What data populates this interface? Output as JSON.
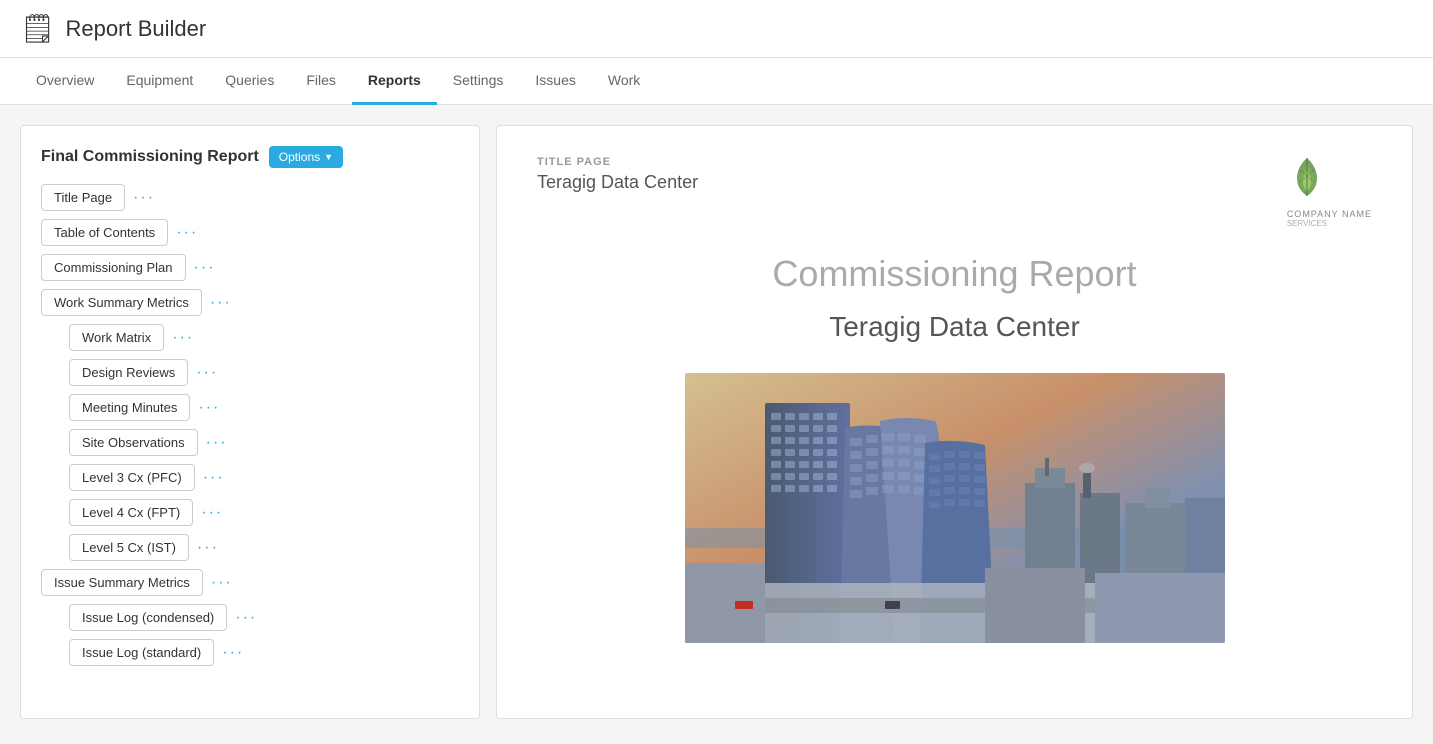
{
  "app": {
    "title": "Report Builder",
    "icon": "📄"
  },
  "nav": {
    "items": [
      {
        "label": "Overview",
        "active": false
      },
      {
        "label": "Equipment",
        "active": false
      },
      {
        "label": "Queries",
        "active": false
      },
      {
        "label": "Files",
        "active": false
      },
      {
        "label": "Reports",
        "active": true
      },
      {
        "label": "Settings",
        "active": false
      },
      {
        "label": "Issues",
        "active": false
      },
      {
        "label": "Work",
        "active": false
      }
    ]
  },
  "left_panel": {
    "report_title": "Final Commissioning Report",
    "options_label": "Options",
    "sections": [
      {
        "label": "Title Page",
        "indented": false,
        "type": "section"
      },
      {
        "label": "Table of Contents",
        "indented": false,
        "type": "section"
      },
      {
        "label": "Commissioning Plan",
        "indented": false,
        "type": "section"
      },
      {
        "label": "Work Summary Metrics",
        "indented": false,
        "type": "group"
      },
      {
        "label": "Work Matrix",
        "indented": true,
        "type": "section"
      },
      {
        "label": "Design Reviews",
        "indented": true,
        "type": "section"
      },
      {
        "label": "Meeting Minutes",
        "indented": true,
        "type": "section"
      },
      {
        "label": "Site Observations",
        "indented": true,
        "type": "section"
      },
      {
        "label": "Level 3 Cx (PFC)",
        "indented": true,
        "type": "section"
      },
      {
        "label": "Level 4 Cx (FPT)",
        "indented": true,
        "type": "section"
      },
      {
        "label": "Level 5 Cx (IST)",
        "indented": true,
        "type": "section"
      },
      {
        "label": "Issue Summary Metrics",
        "indented": false,
        "type": "group"
      },
      {
        "label": "Issue Log (condensed)",
        "indented": true,
        "type": "section"
      },
      {
        "label": "Issue Log (standard)",
        "indented": true,
        "type": "section"
      }
    ]
  },
  "preview": {
    "section_label": "TITLE PAGE",
    "subtitle": "Teragig Data Center",
    "company_name": "COMPANY NAME",
    "main_title": "Commissioning Report",
    "project_name": "Teragig Data Center"
  },
  "colors": {
    "accent": "#29abe2",
    "active_tab_border": "#29abe2"
  }
}
